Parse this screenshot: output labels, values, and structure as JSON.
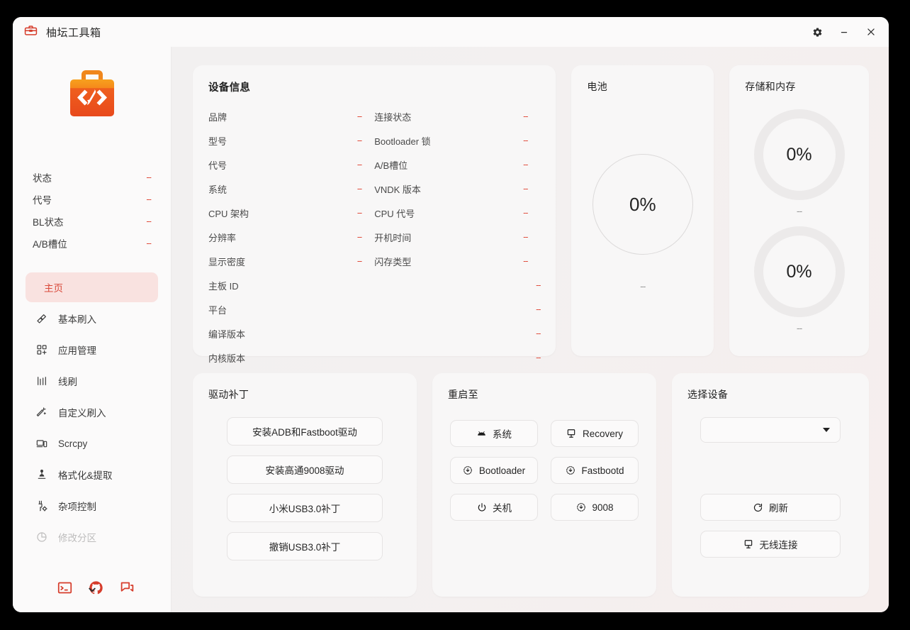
{
  "window": {
    "title": "柚坛工具箱",
    "app_icon": "toolbox-icon",
    "controls": {
      "settings": "gear-icon",
      "minimize": "minimize-icon",
      "close": "close-icon"
    }
  },
  "sidebar": {
    "logo": "toolbox-code-logo",
    "status": [
      {
        "label": "状态",
        "value": "--"
      },
      {
        "label": "代号",
        "value": "--"
      },
      {
        "label": "BL状态",
        "value": "--"
      },
      {
        "label": "A/B槽位",
        "value": "--"
      }
    ],
    "nav": [
      {
        "label": "主页",
        "icon": "",
        "active": true
      },
      {
        "label": "基本刷入",
        "icon": "flash-icon",
        "active": false
      },
      {
        "label": "应用管理",
        "icon": "apps-grid-icon",
        "active": false
      },
      {
        "label": "线刷",
        "icon": "bars-icon",
        "active": false
      },
      {
        "label": "自定义刷入",
        "icon": "magic-wand-icon",
        "active": false
      },
      {
        "label": "Scrcpy",
        "icon": "devices-icon",
        "active": false
      },
      {
        "label": "格式化&提取",
        "icon": "extract-icon",
        "active": false
      },
      {
        "label": "杂项控制",
        "icon": "wrench-gear-icon",
        "active": false
      },
      {
        "label": "修改分区",
        "icon": "pie-icon",
        "active": false,
        "dim": true
      }
    ],
    "footer_icons": [
      {
        "name": "terminal-icon"
      },
      {
        "name": "github-icon"
      },
      {
        "name": "forum-chat-icon"
      }
    ]
  },
  "device_info": {
    "title": "设备信息",
    "items": [
      {
        "label": "品牌",
        "value": "--",
        "full": false
      },
      {
        "label": "连接状态",
        "value": "--",
        "full": false
      },
      {
        "label": "型号",
        "value": "--",
        "full": false
      },
      {
        "label": "Bootloader 锁",
        "value": "--",
        "full": false
      },
      {
        "label": "代号",
        "value": "--",
        "full": false
      },
      {
        "label": "A/B槽位",
        "value": "--",
        "full": false
      },
      {
        "label": "系统",
        "value": "--",
        "full": false
      },
      {
        "label": "VNDK 版本",
        "value": "--",
        "full": false
      },
      {
        "label": "CPU 架构",
        "value": "--",
        "full": false
      },
      {
        "label": "CPU 代号",
        "value": "--",
        "full": false
      },
      {
        "label": "分辨率",
        "value": "--",
        "full": false
      },
      {
        "label": "开机时间",
        "value": "--",
        "full": false
      },
      {
        "label": "显示密度",
        "value": "--",
        "full": false
      },
      {
        "label": "闪存类型",
        "value": "--",
        "full": false
      },
      {
        "label": "主板 ID",
        "value": "--",
        "full": true
      },
      {
        "label": "平台",
        "value": "--",
        "full": true
      },
      {
        "label": "编译版本",
        "value": "--",
        "full": true
      },
      {
        "label": "内核版本",
        "value": "--",
        "full": true
      }
    ]
  },
  "battery": {
    "title": "电池",
    "percent": "0%",
    "sub": "--"
  },
  "storage": {
    "title": "存储和内存",
    "gauges": [
      {
        "percent": "0%",
        "sub": "--"
      },
      {
        "percent": "0%",
        "sub": "--"
      }
    ]
  },
  "driver_patch": {
    "title": "驱动补丁",
    "buttons": [
      {
        "label": "安装ADB和Fastboot驱动"
      },
      {
        "label": "安装高通9008驱动"
      },
      {
        "label": "小米USB3.0补丁"
      },
      {
        "label": "撤销USB3.0补丁"
      }
    ]
  },
  "reboot_to": {
    "title": "重启至",
    "buttons": [
      {
        "label": "系统",
        "icon": "android-icon"
      },
      {
        "label": "Recovery",
        "icon": "monitor-icon"
      },
      {
        "label": "Bootloader",
        "icon": "download-circle-icon"
      },
      {
        "label": "Fastbootd",
        "icon": "download-circle-icon"
      },
      {
        "label": "关机",
        "icon": "power-icon"
      },
      {
        "label": "9008",
        "icon": "download-circle-icon"
      }
    ]
  },
  "device_select": {
    "title": "选择设备",
    "dropdown_value": "",
    "refresh_label": "刷新",
    "wireless_label": "无线连接"
  },
  "colors": {
    "accent_red": "#d9493a",
    "accent_pink_bg": "#f9e2e0",
    "card_bg": "#f8f7f7",
    "window_bg": "#f2f0f0",
    "logo_orange": "#ef6820"
  }
}
